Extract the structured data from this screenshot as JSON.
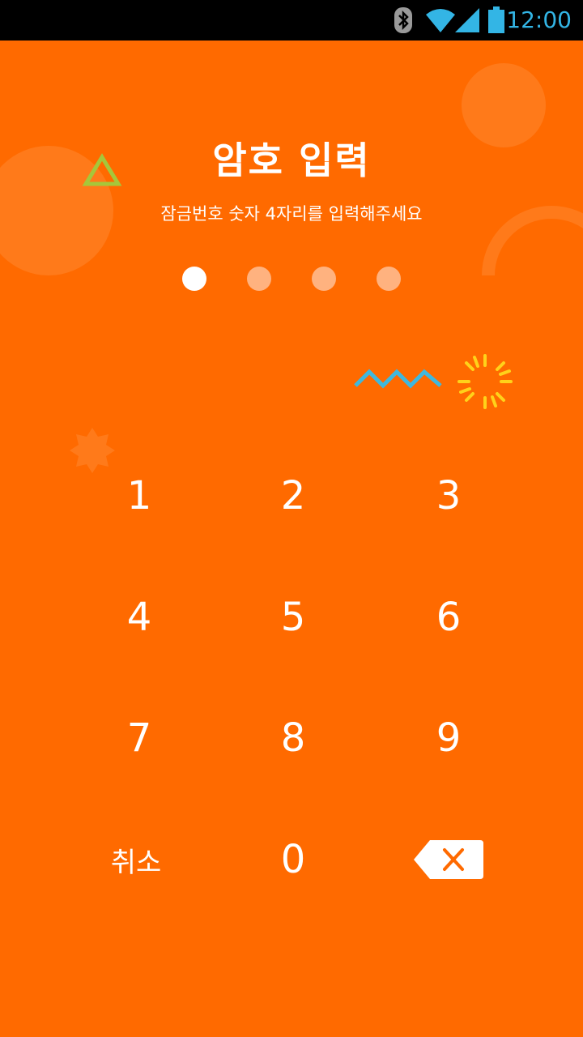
{
  "status_bar": {
    "time": "12:00",
    "icons": [
      "bluetooth-icon",
      "wifi-icon",
      "signal-icon",
      "battery-icon"
    ]
  },
  "header": {
    "title": "암호 입력",
    "subtitle": "잠금번호 숫자 4자리를 입력해주세요"
  },
  "pin": {
    "length": 4,
    "entered": 1
  },
  "keypad": {
    "keys": [
      "1",
      "2",
      "3",
      "4",
      "5",
      "6",
      "7",
      "8",
      "9"
    ],
    "zero": "0",
    "cancel_label": "취소",
    "backspace_icon": "backspace-icon"
  },
  "colors": {
    "background": "#ff6a00",
    "dot_filled": "#ffffff",
    "dot_empty": "#ffb27f",
    "status_accent": "#33b5e5"
  }
}
